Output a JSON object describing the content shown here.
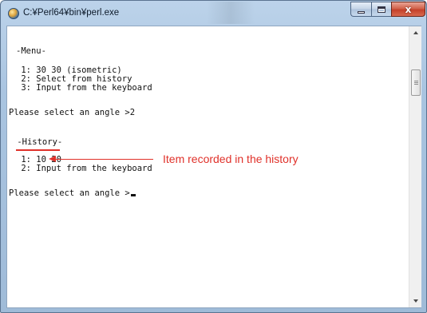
{
  "window": {
    "title": "C:¥Perl64¥bin¥perl.exe",
    "close_glyph": "x"
  },
  "console": {
    "lines": [
      "-Menu-",
      " 1: 30 30 (isometric)",
      " 2: Select from history",
      " 3: Input from the keyboard",
      "Please select an angle >2",
      " -History-",
      " 1: 10 20",
      " 2: Input from the keyboard",
      "Please select an angle >"
    ]
  },
  "annotation": {
    "label": "Item recorded in the history",
    "color": "#e0312a"
  },
  "colors": {
    "frame": "#a9c4e0",
    "close_button": "#c4412a",
    "console_background": "#ffffff",
    "console_text": "#111111"
  },
  "icons": [
    "perl-app-icon",
    "minimize-icon",
    "maximize-icon",
    "close-icon",
    "scroll-up-icon",
    "scroll-down-icon"
  ]
}
